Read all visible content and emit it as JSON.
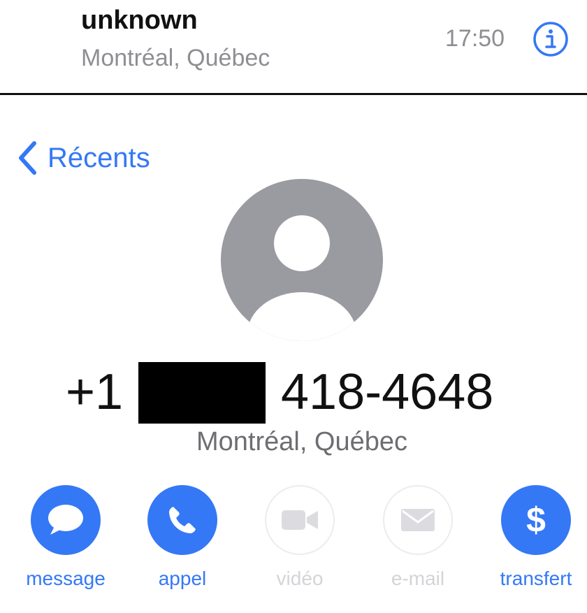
{
  "recent_call": {
    "name": "unknown",
    "location": "Montréal, Québec",
    "time": "17:50",
    "info_icon": "info-circle-icon"
  },
  "nav": {
    "back_label": "Récents",
    "back_icon": "chevron-left-icon"
  },
  "contact": {
    "avatar_icon": "person-silhouette-icon",
    "number_prefix": "+1",
    "number_suffix": "418-4648",
    "location": "Montréal, Québec"
  },
  "actions": [
    {
      "label": "message",
      "icon": "speech-bubble-icon",
      "enabled": true
    },
    {
      "label": "appel",
      "icon": "phone-icon",
      "enabled": true
    },
    {
      "label": "vidéo",
      "icon": "video-camera-icon",
      "enabled": false
    },
    {
      "label": "e-mail",
      "icon": "envelope-icon",
      "enabled": false
    },
    {
      "label": "transfert",
      "icon": "dollar-icon",
      "enabled": true
    }
  ],
  "colors": {
    "accent": "#3478f6",
    "secondary_text": "#8e8e93",
    "disabled": "#d4d4d8",
    "avatar_bg": "#9a9aa1"
  }
}
